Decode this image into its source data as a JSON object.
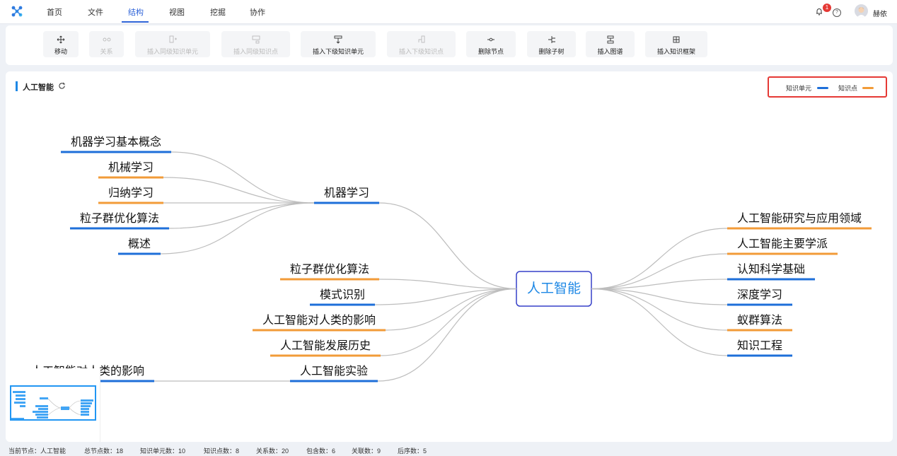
{
  "nav": {
    "items": [
      "首页",
      "文件",
      "结构",
      "视图",
      "挖掘",
      "协作"
    ],
    "active_index": 2,
    "notification_count": "1",
    "user_name": "赫依"
  },
  "toolbar": {
    "tools": [
      {
        "label": "移动",
        "icon": "move-icon",
        "enabled": true
      },
      {
        "label": "关系",
        "icon": "relation-icon",
        "enabled": false
      },
      {
        "label": "插入同级知识单元",
        "icon": "insert-sibling-unit-icon",
        "enabled": false
      },
      {
        "label": "插入同级知识点",
        "icon": "insert-sibling-point-icon",
        "enabled": false
      },
      {
        "label": "插入下级知识单元",
        "icon": "insert-child-unit-icon",
        "enabled": true
      },
      {
        "label": "插入下级知识点",
        "icon": "insert-child-point-icon",
        "enabled": false
      },
      {
        "label": "删除节点",
        "icon": "delete-node-icon",
        "enabled": true
      },
      {
        "label": "删除子树",
        "icon": "delete-subtree-icon",
        "enabled": true
      },
      {
        "label": "插入图谱",
        "icon": "insert-graph-icon",
        "enabled": true
      },
      {
        "label": "插入知识框架",
        "icon": "insert-framework-icon",
        "enabled": true
      }
    ]
  },
  "canvas": {
    "title": "人工智能",
    "legend": [
      {
        "label": "知识单元",
        "color": "#1e6fd9"
      },
      {
        "label": "知识点",
        "color": "#f29b38"
      }
    ]
  },
  "mindmap": {
    "root": "人工智能",
    "left": [
      {
        "label": "机器学习",
        "type": "unit",
        "children": [
          {
            "label": "机器学习基本概念",
            "type": "unit"
          },
          {
            "label": "机械学习",
            "type": "point"
          },
          {
            "label": "归纳学习",
            "type": "point"
          },
          {
            "label": "粒子群优化算法",
            "type": "unit"
          },
          {
            "label": "概述",
            "type": "unit"
          }
        ]
      },
      {
        "label": "粒子群优化算法",
        "type": "point"
      },
      {
        "label": "模式识别",
        "type": "unit"
      },
      {
        "label": "人工智能对人类的影响",
        "type": "point"
      },
      {
        "label": "人工智能发展历史",
        "type": "point"
      },
      {
        "label": "人工智能实验",
        "type": "unit",
        "children": [
          {
            "label": "人工智能对人类的影响",
            "type": "unit"
          }
        ]
      }
    ],
    "right": [
      {
        "label": "人工智能研究与应用领域",
        "type": "point"
      },
      {
        "label": "人工智能主要学派",
        "type": "point"
      },
      {
        "label": "认知科学基础",
        "type": "unit"
      },
      {
        "label": "深度学习",
        "type": "unit"
      },
      {
        "label": "蚁群算法",
        "type": "point"
      },
      {
        "label": "知识工程",
        "type": "unit"
      }
    ]
  },
  "status": {
    "current_node": "当前节点：人工智能",
    "total_nodes": "总节点数：18",
    "unit_count": "知识单元数：10",
    "point_count": "知识点数：8",
    "relation_count": "关系数：20",
    "contain_count": "包含数：6",
    "assoc_count": "关联数：9",
    "order_count": "后序数：5"
  }
}
